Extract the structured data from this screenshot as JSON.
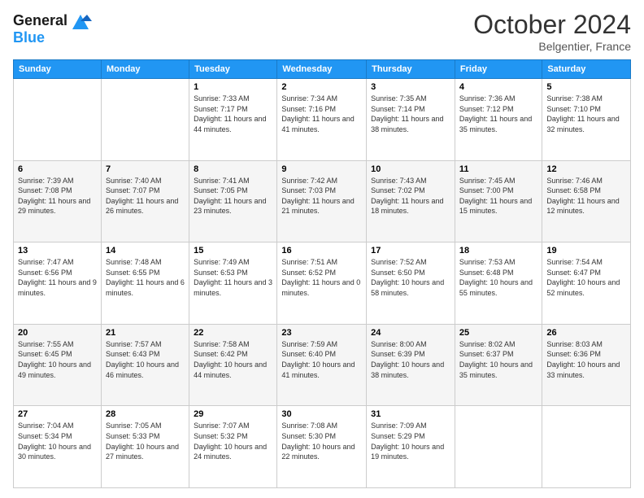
{
  "header": {
    "logo_line1": "General",
    "logo_line2": "Blue",
    "month": "October 2024",
    "location": "Belgentier, France"
  },
  "days_of_week": [
    "Sunday",
    "Monday",
    "Tuesday",
    "Wednesday",
    "Thursday",
    "Friday",
    "Saturday"
  ],
  "weeks": [
    [
      {
        "day": "",
        "sunrise": "",
        "sunset": "",
        "daylight": ""
      },
      {
        "day": "",
        "sunrise": "",
        "sunset": "",
        "daylight": ""
      },
      {
        "day": "1",
        "sunrise": "Sunrise: 7:33 AM",
        "sunset": "Sunset: 7:17 PM",
        "daylight": "Daylight: 11 hours and 44 minutes."
      },
      {
        "day": "2",
        "sunrise": "Sunrise: 7:34 AM",
        "sunset": "Sunset: 7:16 PM",
        "daylight": "Daylight: 11 hours and 41 minutes."
      },
      {
        "day": "3",
        "sunrise": "Sunrise: 7:35 AM",
        "sunset": "Sunset: 7:14 PM",
        "daylight": "Daylight: 11 hours and 38 minutes."
      },
      {
        "day": "4",
        "sunrise": "Sunrise: 7:36 AM",
        "sunset": "Sunset: 7:12 PM",
        "daylight": "Daylight: 11 hours and 35 minutes."
      },
      {
        "day": "5",
        "sunrise": "Sunrise: 7:38 AM",
        "sunset": "Sunset: 7:10 PM",
        "daylight": "Daylight: 11 hours and 32 minutes."
      }
    ],
    [
      {
        "day": "6",
        "sunrise": "Sunrise: 7:39 AM",
        "sunset": "Sunset: 7:08 PM",
        "daylight": "Daylight: 11 hours and 29 minutes."
      },
      {
        "day": "7",
        "sunrise": "Sunrise: 7:40 AM",
        "sunset": "Sunset: 7:07 PM",
        "daylight": "Daylight: 11 hours and 26 minutes."
      },
      {
        "day": "8",
        "sunrise": "Sunrise: 7:41 AM",
        "sunset": "Sunset: 7:05 PM",
        "daylight": "Daylight: 11 hours and 23 minutes."
      },
      {
        "day": "9",
        "sunrise": "Sunrise: 7:42 AM",
        "sunset": "Sunset: 7:03 PM",
        "daylight": "Daylight: 11 hours and 21 minutes."
      },
      {
        "day": "10",
        "sunrise": "Sunrise: 7:43 AM",
        "sunset": "Sunset: 7:02 PM",
        "daylight": "Daylight: 11 hours and 18 minutes."
      },
      {
        "day": "11",
        "sunrise": "Sunrise: 7:45 AM",
        "sunset": "Sunset: 7:00 PM",
        "daylight": "Daylight: 11 hours and 15 minutes."
      },
      {
        "day": "12",
        "sunrise": "Sunrise: 7:46 AM",
        "sunset": "Sunset: 6:58 PM",
        "daylight": "Daylight: 11 hours and 12 minutes."
      }
    ],
    [
      {
        "day": "13",
        "sunrise": "Sunrise: 7:47 AM",
        "sunset": "Sunset: 6:56 PM",
        "daylight": "Daylight: 11 hours and 9 minutes."
      },
      {
        "day": "14",
        "sunrise": "Sunrise: 7:48 AM",
        "sunset": "Sunset: 6:55 PM",
        "daylight": "Daylight: 11 hours and 6 minutes."
      },
      {
        "day": "15",
        "sunrise": "Sunrise: 7:49 AM",
        "sunset": "Sunset: 6:53 PM",
        "daylight": "Daylight: 11 hours and 3 minutes."
      },
      {
        "day": "16",
        "sunrise": "Sunrise: 7:51 AM",
        "sunset": "Sunset: 6:52 PM",
        "daylight": "Daylight: 11 hours and 0 minutes."
      },
      {
        "day": "17",
        "sunrise": "Sunrise: 7:52 AM",
        "sunset": "Sunset: 6:50 PM",
        "daylight": "Daylight: 10 hours and 58 minutes."
      },
      {
        "day": "18",
        "sunrise": "Sunrise: 7:53 AM",
        "sunset": "Sunset: 6:48 PM",
        "daylight": "Daylight: 10 hours and 55 minutes."
      },
      {
        "day": "19",
        "sunrise": "Sunrise: 7:54 AM",
        "sunset": "Sunset: 6:47 PM",
        "daylight": "Daylight: 10 hours and 52 minutes."
      }
    ],
    [
      {
        "day": "20",
        "sunrise": "Sunrise: 7:55 AM",
        "sunset": "Sunset: 6:45 PM",
        "daylight": "Daylight: 10 hours and 49 minutes."
      },
      {
        "day": "21",
        "sunrise": "Sunrise: 7:57 AM",
        "sunset": "Sunset: 6:43 PM",
        "daylight": "Daylight: 10 hours and 46 minutes."
      },
      {
        "day": "22",
        "sunrise": "Sunrise: 7:58 AM",
        "sunset": "Sunset: 6:42 PM",
        "daylight": "Daylight: 10 hours and 44 minutes."
      },
      {
        "day": "23",
        "sunrise": "Sunrise: 7:59 AM",
        "sunset": "Sunset: 6:40 PM",
        "daylight": "Daylight: 10 hours and 41 minutes."
      },
      {
        "day": "24",
        "sunrise": "Sunrise: 8:00 AM",
        "sunset": "Sunset: 6:39 PM",
        "daylight": "Daylight: 10 hours and 38 minutes."
      },
      {
        "day": "25",
        "sunrise": "Sunrise: 8:02 AM",
        "sunset": "Sunset: 6:37 PM",
        "daylight": "Daylight: 10 hours and 35 minutes."
      },
      {
        "day": "26",
        "sunrise": "Sunrise: 8:03 AM",
        "sunset": "Sunset: 6:36 PM",
        "daylight": "Daylight: 10 hours and 33 minutes."
      }
    ],
    [
      {
        "day": "27",
        "sunrise": "Sunrise: 7:04 AM",
        "sunset": "Sunset: 5:34 PM",
        "daylight": "Daylight: 10 hours and 30 minutes."
      },
      {
        "day": "28",
        "sunrise": "Sunrise: 7:05 AM",
        "sunset": "Sunset: 5:33 PM",
        "daylight": "Daylight: 10 hours and 27 minutes."
      },
      {
        "day": "29",
        "sunrise": "Sunrise: 7:07 AM",
        "sunset": "Sunset: 5:32 PM",
        "daylight": "Daylight: 10 hours and 24 minutes."
      },
      {
        "day": "30",
        "sunrise": "Sunrise: 7:08 AM",
        "sunset": "Sunset: 5:30 PM",
        "daylight": "Daylight: 10 hours and 22 minutes."
      },
      {
        "day": "31",
        "sunrise": "Sunrise: 7:09 AM",
        "sunset": "Sunset: 5:29 PM",
        "daylight": "Daylight: 10 hours and 19 minutes."
      },
      {
        "day": "",
        "sunrise": "",
        "sunset": "",
        "daylight": ""
      },
      {
        "day": "",
        "sunrise": "",
        "sunset": "",
        "daylight": ""
      }
    ]
  ]
}
